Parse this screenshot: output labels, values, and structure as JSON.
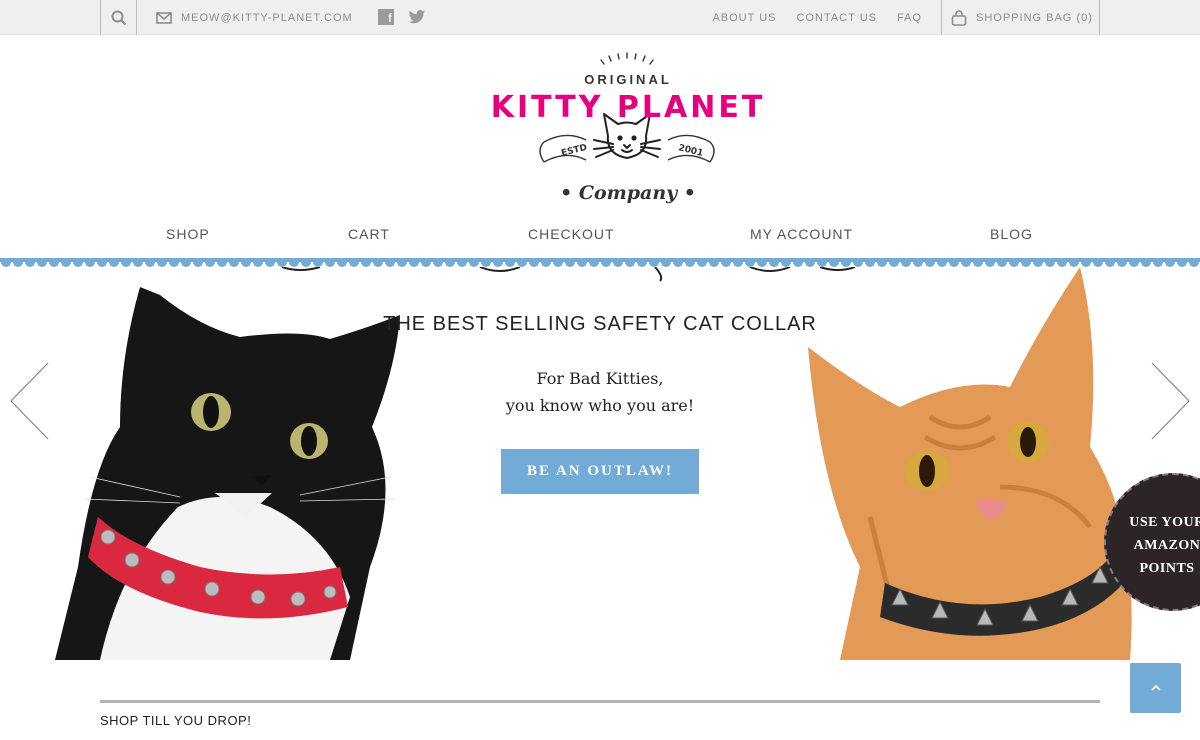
{
  "topbar": {
    "email": "MEOW@KITTY-PLANET.COM",
    "social": [
      "facebook-icon",
      "twitter-icon"
    ],
    "facebook_glyph": "f",
    "links": [
      "ABOUT US",
      "CONTACT US",
      "FAQ"
    ],
    "bag_label": "SHOPPING BAG (0)"
  },
  "logo": {
    "original": "ORIGINAL",
    "title": "KITTY PLANET",
    "estd_left": "ESTD",
    "estd_right": "2001",
    "company": "• Company •",
    "title_color": "#e6007e"
  },
  "nav": {
    "items": [
      "SHOP",
      "CART",
      "CHECKOUT",
      "MY ACCOUNT",
      "BLOG"
    ]
  },
  "hero": {
    "title": "THE BEST SELLING SAFETY CAT COLLAR",
    "subtitle_line1": "For Bad Kitties,",
    "subtitle_line2": "you know who you are!",
    "cta_label": "BE AN OUTLAW!",
    "badge_line1": "USE YOUR",
    "badge_line2": "AMAZON",
    "badge_line3": "POINTS",
    "accent_color": "#72abd6",
    "collar_left_color": "#d9283f",
    "collar_right_color": "#2b2b2b"
  },
  "section": {
    "title": "SHOP TILL YOU DROP!"
  },
  "back_to_top_icon": "chevron-up-icon"
}
